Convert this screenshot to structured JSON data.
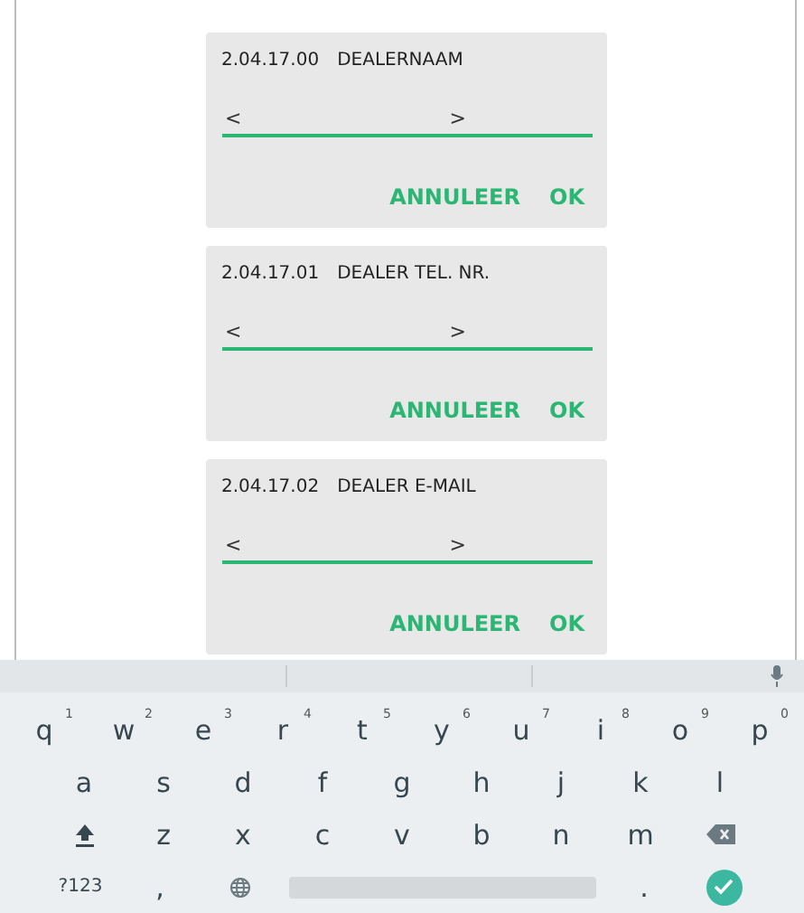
{
  "dialogs": [
    {
      "code": "2.04.17.00",
      "title": "DEALERNAAM",
      "field_start": "<",
      "field_end": ">",
      "buttons": [
        "ANNULEER",
        "OK"
      ]
    },
    {
      "code": "2.04.17.01",
      "title": "DEALER TEL. NR.",
      "field_start": "<",
      "field_end": ">",
      "buttons": [
        "ANNULEER",
        "OK"
      ]
    },
    {
      "code": "2.04.17.02",
      "title": "DEALER E-MAIL",
      "field_start": "<",
      "field_end": ">",
      "buttons": [
        "ANNULEER",
        "OK"
      ]
    }
  ],
  "keyboard": {
    "key_lines": [
      [
        {
          "kind": "letter",
          "label": "q",
          "hint": "1"
        },
        {
          "kind": "letter",
          "label": "w",
          "hint": "2"
        },
        {
          "kind": "letter",
          "label": "e",
          "hint": "3"
        },
        {
          "kind": "letter",
          "label": "r",
          "hint": "4"
        },
        {
          "kind": "letter",
          "label": "t",
          "hint": "5"
        },
        {
          "kind": "letter",
          "label": "y",
          "hint": "6"
        },
        {
          "kind": "letter",
          "label": "u",
          "hint": "7"
        },
        {
          "kind": "letter",
          "label": "i",
          "hint": "8"
        },
        {
          "kind": "letter",
          "label": "o",
          "hint": "9"
        },
        {
          "kind": "letter",
          "label": "p",
          "hint": "0"
        }
      ],
      [
        {
          "kind": "letter",
          "label": "a"
        },
        {
          "kind": "letter",
          "label": "s"
        },
        {
          "kind": "letter",
          "label": "d"
        },
        {
          "kind": "letter",
          "label": "f"
        },
        {
          "kind": "letter",
          "label": "g"
        },
        {
          "kind": "letter",
          "label": "h"
        },
        {
          "kind": "letter",
          "label": "j"
        },
        {
          "kind": "letter",
          "label": "k"
        },
        {
          "kind": "letter",
          "label": "l"
        }
      ],
      [
        {
          "kind": "shift"
        },
        {
          "kind": "letter",
          "label": "z"
        },
        {
          "kind": "letter",
          "label": "x"
        },
        {
          "kind": "letter",
          "label": "c"
        },
        {
          "kind": "letter",
          "label": "v"
        },
        {
          "kind": "letter",
          "label": "b"
        },
        {
          "kind": "letter",
          "label": "n"
        },
        {
          "kind": "letter",
          "label": "m"
        },
        {
          "kind": "backspace"
        }
      ],
      [
        {
          "kind": "symbols",
          "label": "?123"
        },
        {
          "kind": "letter",
          "label": ","
        },
        {
          "kind": "globe"
        },
        {
          "kind": "space"
        },
        {
          "kind": "letter",
          "label": "."
        },
        {
          "kind": "enter"
        }
      ]
    ]
  }
}
